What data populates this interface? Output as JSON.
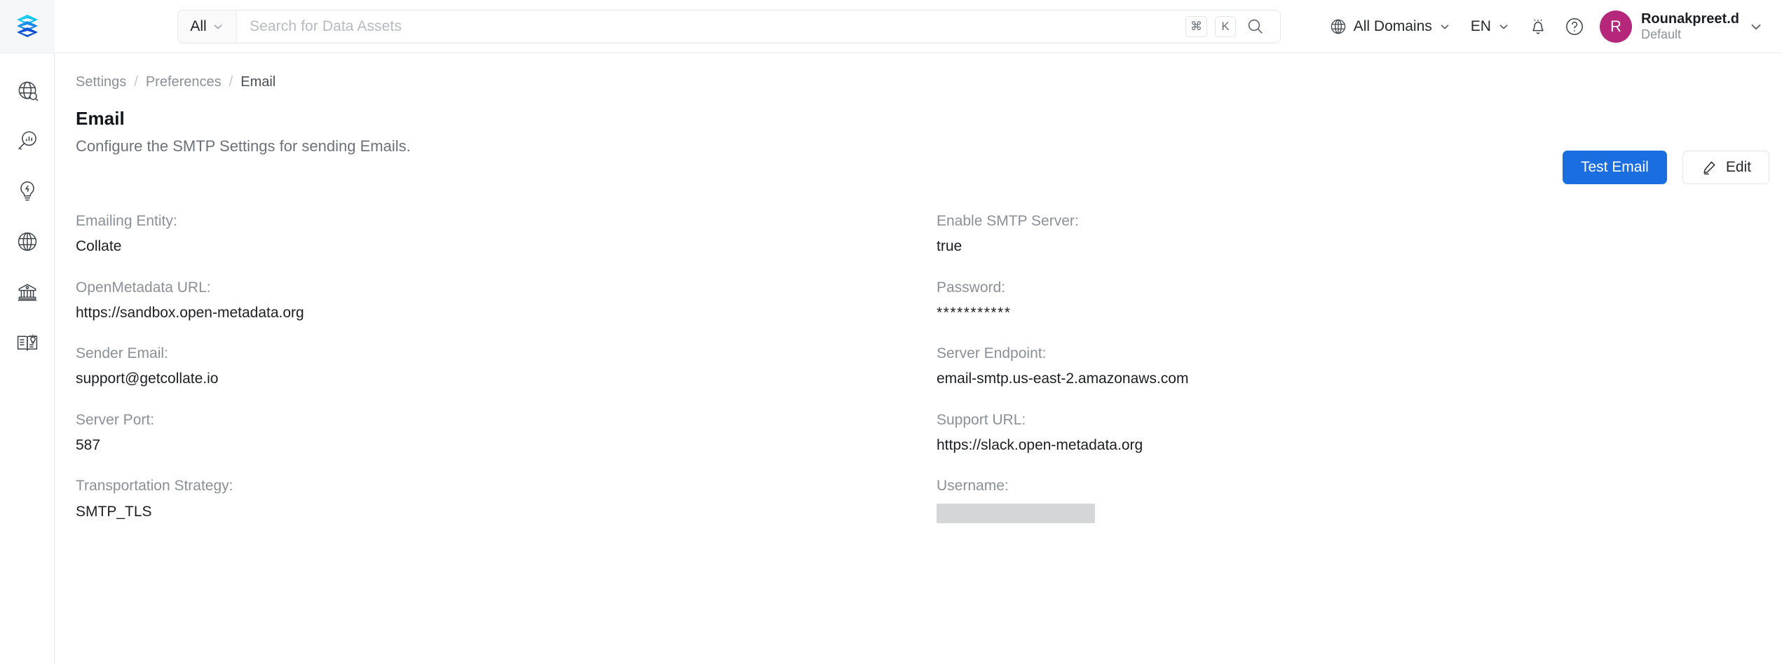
{
  "brand": {
    "logo_icon": "stacked-layers-logo",
    "accent_blue": "#1a6ee0",
    "avatar_color": "#b4277a"
  },
  "sidebar": {
    "items": [
      {
        "icon": "globe-search-icon",
        "name": "explore"
      },
      {
        "icon": "magnifier-chart-icon",
        "name": "insights"
      },
      {
        "icon": "lightbulb-bolt-icon",
        "name": "automations"
      },
      {
        "icon": "globe-icon",
        "name": "domains"
      },
      {
        "icon": "bank-icon",
        "name": "governance"
      },
      {
        "icon": "open-book-lightbulb-icon",
        "name": "knowledge-center"
      }
    ]
  },
  "search": {
    "scope_label": "All",
    "placeholder": "Search for Data Assets",
    "shortcut_modifier": "⌘",
    "shortcut_key": "K",
    "search_icon": "search-icon"
  },
  "header": {
    "domains_label": "All Domains",
    "domains_icon": "globe-icon",
    "language_label": "EN",
    "notifications_icon": "bell-icon",
    "help_icon": "help-circle-icon",
    "chevron_icon": "chevron-down-icon",
    "user": {
      "avatar_initial": "R",
      "name": "Rounakpreet.d",
      "persona": "Default"
    }
  },
  "breadcrumb": {
    "items": [
      {
        "label": "Settings"
      },
      {
        "label": "Preferences"
      },
      {
        "label": "Email"
      }
    ],
    "separator": "/"
  },
  "page": {
    "title": "Email",
    "subtitle": "Configure the SMTP Settings for sending Emails."
  },
  "actions": {
    "test_email_label": "Test Email",
    "edit_label": "Edit",
    "edit_icon": "pencil-icon"
  },
  "fields": {
    "left": [
      {
        "label": "Emailing Entity:",
        "value": "Collate",
        "type": "text"
      },
      {
        "label": "OpenMetadata URL:",
        "value": "https://sandbox.open-metadata.org",
        "type": "text"
      },
      {
        "label": "Sender Email:",
        "value": "support@getcollate.io",
        "type": "text"
      },
      {
        "label": "Server Port:",
        "value": "587",
        "type": "text"
      },
      {
        "label": "Transportation Strategy:",
        "value": "SMTP_TLS",
        "type": "text"
      }
    ],
    "right": [
      {
        "label": "Enable SMTP Server:",
        "value": "true",
        "type": "text"
      },
      {
        "label": "Password:",
        "value": "***********",
        "type": "mask"
      },
      {
        "label": "Server Endpoint:",
        "value": "email-smtp.us-east-2.amazonaws.com",
        "type": "text"
      },
      {
        "label": "Support URL:",
        "value": "https://slack.open-metadata.org",
        "type": "text"
      },
      {
        "label": "Username:",
        "value": "",
        "type": "redacted"
      }
    ]
  }
}
